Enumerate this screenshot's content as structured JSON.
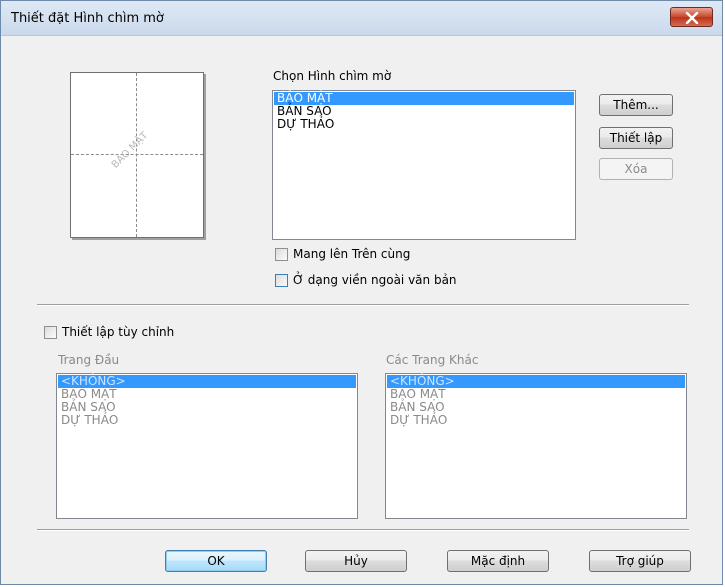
{
  "window": {
    "title": "Thiết đặt Hình chìm mờ",
    "close_label": "close"
  },
  "preview": {
    "watermark_text": "BẢO MẬT"
  },
  "choose": {
    "label": "Chọn Hình chìm mờ",
    "items": [
      "BẢO MẬT",
      "BẢN SAO",
      "DỰ THẢO"
    ],
    "selected": 0
  },
  "side_buttons": {
    "add": "Thêm...",
    "settings": "Thiết lập",
    "delete": "Xóa"
  },
  "options": {
    "bring_to_front": "Mang lên Trên cùng",
    "outline_text": "Ở dạng viền ngoài văn bản"
  },
  "custom": {
    "label": "Thiết lập tùy chỉnh",
    "first_page": {
      "label": "Trang Đầu",
      "items": [
        "<KHÔNG>",
        "BẢO MẬT",
        "BẢN SAO",
        "DỰ THẢO"
      ]
    },
    "other_pages": {
      "label": "Các Trang Khác",
      "items": [
        "<KHÔNG>",
        "BẢO MẬT",
        "BẢN SAO",
        "DỰ THẢO"
      ]
    }
  },
  "footer": {
    "ok": "OK",
    "cancel": "Hủy",
    "default": "Mặc định",
    "help": "Trợ giúp"
  }
}
